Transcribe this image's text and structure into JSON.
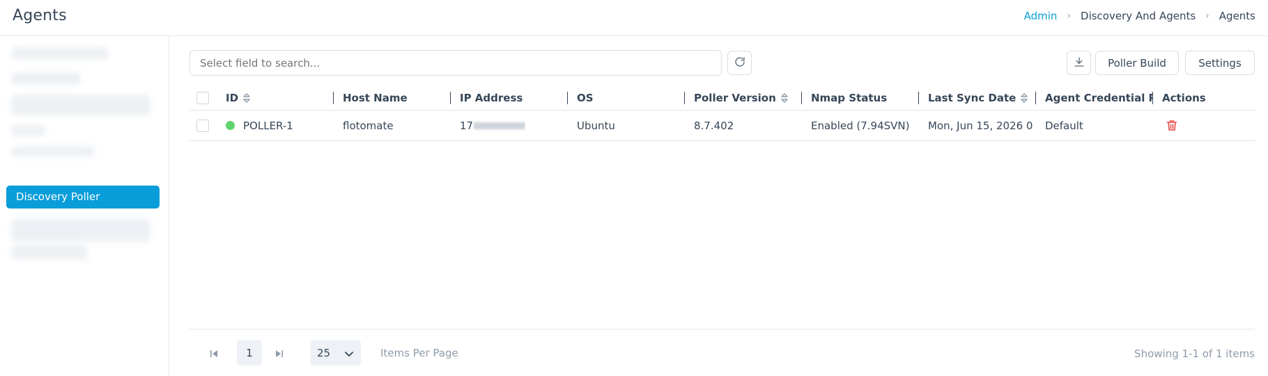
{
  "header": {
    "title": "Agents",
    "breadcrumb": [
      "Admin",
      "Discovery And Agents",
      "Agents"
    ]
  },
  "sidebar": {
    "active_item": "Discovery Poller"
  },
  "toolbar": {
    "search_placeholder": "Select field to search...",
    "poller_build_label": "Poller Build",
    "settings_label": "Settings"
  },
  "table": {
    "columns": [
      "ID",
      "Host Name",
      "IP Address",
      "OS",
      "Poller Version",
      "Nmap Status",
      "Last Sync Date",
      "Agent Credential P...",
      "Actions"
    ],
    "rows": [
      {
        "id": "POLLER-1",
        "host_name": "flotomate",
        "ip_prefix": "17",
        "os": "Ubuntu",
        "poller_version": "8.7.402",
        "nmap_status": "Enabled (7.94SVN)",
        "last_sync_date": "Mon, Jun 15, 2026 0...",
        "agent_credential": "Default",
        "status_color": "#5fd36e"
      }
    ]
  },
  "pagination": {
    "current_page": "1",
    "per_page": "25",
    "items_per_page_label": "Items Per Page",
    "showing_text": "Showing 1-1 of 1 items"
  },
  "colors": {
    "accent": "#099dd9",
    "text": "#364658",
    "muted": "#8e9baa",
    "danger": "#e84b4b",
    "online": "#5fd36e"
  }
}
